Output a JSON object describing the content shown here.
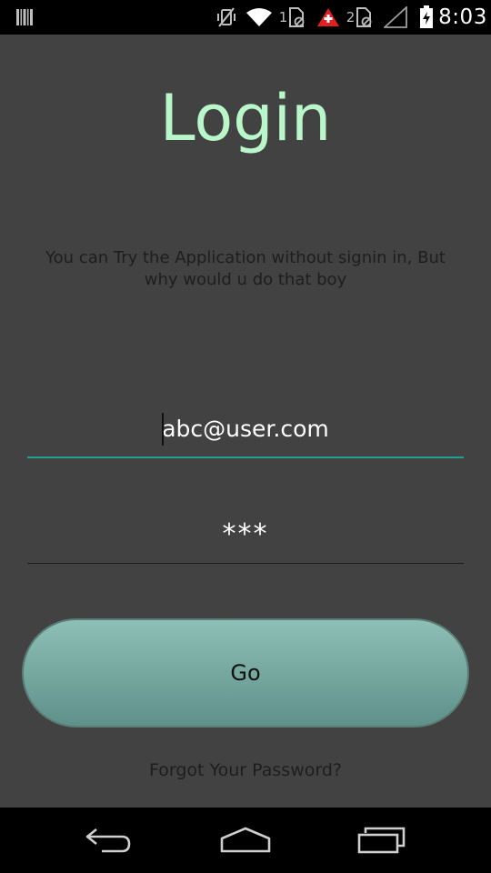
{
  "status_bar": {
    "notification_icon": "barcode-notification-icon",
    "icons": [
      "vibrate-off-icon",
      "wifi-icon",
      "sim1-icon",
      "warning-icon",
      "sim2-icon",
      "no-signal-icon",
      "battery-charging-icon"
    ],
    "sim1_label": "1",
    "sim2_label": "2",
    "time": "8:03"
  },
  "login": {
    "title": "Login",
    "subtitle": "You can Try the Application without signin in, But why would u do that boy",
    "email_value": "abc@user.com",
    "password_value": "***",
    "go_label": "Go",
    "forgot_label": "Forgot Your Password?"
  },
  "nav_bar": {
    "icons": [
      "back-icon",
      "home-icon",
      "recent-apps-icon"
    ]
  },
  "colors": {
    "background": "#424242",
    "title": "#b9f6ca",
    "accent_underline": "#1fa090",
    "button": "#7aaba2",
    "muted_text": "#1e1e1e"
  }
}
